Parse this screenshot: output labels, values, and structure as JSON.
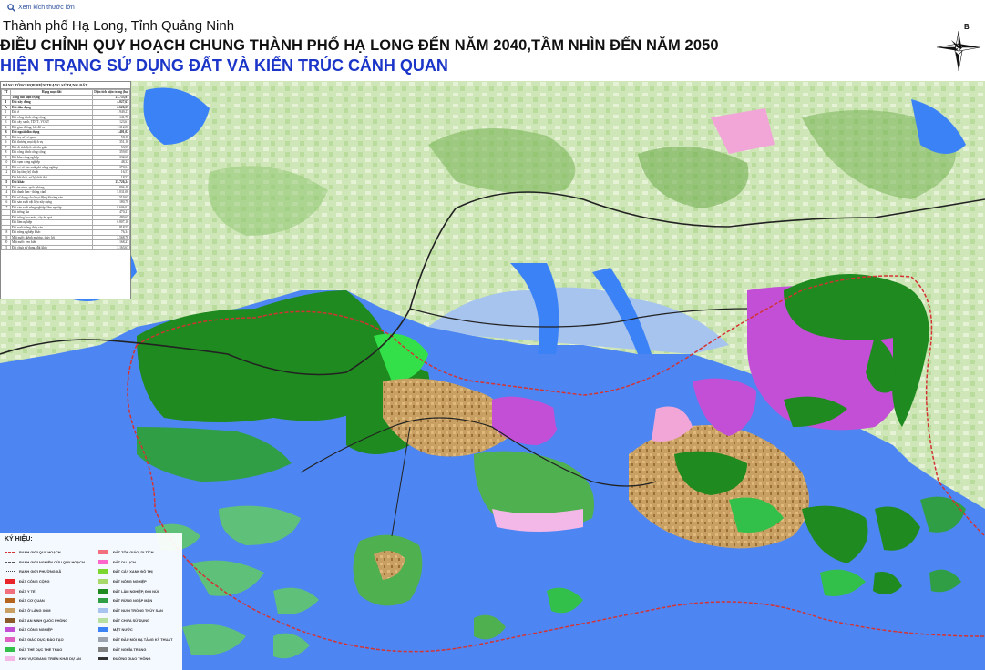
{
  "header": {
    "view_link": "Xem kích thước lớn",
    "location": "Thành phố Hạ Long, Tỉnh Quảng Ninh",
    "title": "ĐIỀU CHỈNH QUY HOẠCH CHUNG THÀNH PHỐ HẠ LONG ĐẾN NĂM 2040,TẦM NHÌN ĐẾN NĂM 2050",
    "subtitle": "HIỆN TRẠNG SỬ DỤNG ĐẤT VÀ KIẾN TRÚC CẢNH QUAN",
    "compass_letter": "B"
  },
  "stats": {
    "title": "BẢNG TỔNG HỢP HIỆN TRẠNG SỬ DỤNG ĐẤT",
    "col_tt": "TT",
    "col_name": "Hạng mục đất",
    "col_area": "Diện tích hiện trạng (ha)",
    "rows": [
      {
        "no": "",
        "name": "Tổng đất hiện trạng",
        "value": "27.753,91",
        "bold": true
      },
      {
        "no": "I",
        "name": "Đất xây dựng",
        "value": "4.027,67",
        "bold": true
      },
      {
        "no": "A",
        "name": "Đất dân dụng",
        "value": "2.626,55",
        "bold": true
      },
      {
        "no": "1",
        "name": "Đất ở",
        "value": "1.949,27",
        "bold": false
      },
      {
        "no": "2",
        "name": "Đất công trình công cộng",
        "value": "141,78",
        "bold": false
      },
      {
        "no": "3",
        "name": "Đất cây xanh, TDTT, VCGT",
        "value": "123,61",
        "bold": false
      },
      {
        "no": "4",
        "name": "Đất giao thông, bãi đỗ xe",
        "value": "1.312,06",
        "bold": false
      },
      {
        "no": "B",
        "name": "Đất ngoài dân dụng",
        "value": "1.401,02",
        "bold": true
      },
      {
        "no": "5",
        "name": "Đất trụ sở cơ quan",
        "value": "58,18",
        "bold": false
      },
      {
        "no": "6",
        "name": "Đất thương mại dịch vụ",
        "value": "351,16",
        "bold": false
      },
      {
        "no": "7",
        "name": "Đất di tích lịch sử, tôn giáo",
        "value": "53,95",
        "bold": false
      },
      {
        "no": "8",
        "name": "Đất công trình công cộng",
        "value": "359,05",
        "bold": false
      },
      {
        "no": "9",
        "name": "Đất khu công nghiệp",
        "value": "332,68",
        "bold": false
      },
      {
        "no": "10",
        "name": "Đất cụm công nghiệp",
        "value": "48,32",
        "bold": false
      },
      {
        "no": "11",
        "name": "Đất cơ sở sản xuất phi nông nghiệp",
        "value": "370,54",
        "bold": false
      },
      {
        "no": "12",
        "name": "Đất hạ tầng kỹ thuật",
        "value": "16,57",
        "bold": false
      },
      {
        "no": "",
        "name": "Đất bãi thải, xử lý chất thải",
        "value": "18,57",
        "bold": false
      },
      {
        "no": "II",
        "name": "Đất khác",
        "value": "23.726,24",
        "bold": true
      },
      {
        "no": "13",
        "name": "Đất an ninh, quốc phòng",
        "value": "806,48",
        "bold": false
      },
      {
        "no": "14",
        "name": "Đất danh lam - thắng cảnh",
        "value": "5.031,06",
        "bold": false
      },
      {
        "no": "15",
        "name": "Đất sử dụng cho hoạt động khoáng sản",
        "value": "1.519,65",
        "bold": false
      },
      {
        "no": "16",
        "name": "Đất sản xuất vật liệu xây dựng",
        "value": "180,78",
        "bold": false
      },
      {
        "no": "17",
        "name": "Đất sản xuất nông nghiệp, lâm nghiệp",
        "value": "9.606,01",
        "bold": false
      },
      {
        "no": "",
        "name": "Đất trồng lúa",
        "value": "470,21",
        "bold": false
      },
      {
        "no": "",
        "name": "Đất trồng hoa màu, cây ăn quả",
        "value": "1.490,65",
        "bold": false
      },
      {
        "no": "",
        "name": "Đất lâm nghiệp",
        "value": "6.807,16",
        "bold": false
      },
      {
        "no": "",
        "name": "Đất nuôi trồng thủy sản",
        "value": "818,55",
        "bold": false
      },
      {
        "no": "18",
        "name": "Đất nông nghiệp khác",
        "value": "76,34",
        "bold": false
      },
      {
        "no": "19",
        "name": "Mặt nước, kênh mương, thủy lợi",
        "value": "2.568,76",
        "bold": false
      },
      {
        "no": "20",
        "name": "Mặt nước ven biển",
        "value": "168,27",
        "bold": false
      },
      {
        "no": "21",
        "name": "Đất chưa sử dụng, đất khác",
        "value": "3.163,67",
        "bold": false
      }
    ]
  },
  "legend": {
    "title": "KÝ HIỆU:",
    "left": [
      {
        "label": "RANH GIỚI QUY HOẠCH",
        "color": "#d33333",
        "kind": "line"
      },
      {
        "label": "RANH GIỚI NGHIÊN CỨU QUY HOẠCH",
        "color": "#555555",
        "kind": "line2"
      },
      {
        "label": "RANH GIỚI PHƯỜNG XÃ",
        "color": "#444444",
        "kind": "line3"
      },
      {
        "label": "ĐẤT CÔNG CỘNG",
        "color": "#e8232a",
        "kind": "fill"
      },
      {
        "label": "ĐẤT Y TẾ",
        "color": "#f2707d",
        "kind": "fill"
      },
      {
        "label": "ĐẤT CƠ QUAN",
        "color": "#b5651d",
        "kind": "fill"
      },
      {
        "label": "ĐẤT Ở LÀNG XÓM",
        "color": "#c8a063",
        "kind": "fill"
      },
      {
        "label": "ĐẤT AN NINH QUỐC PHÒNG",
        "color": "#8b5a2b",
        "kind": "fill"
      },
      {
        "label": "ĐẤT CÔNG NGHIỆP",
        "color": "#c24fd6",
        "kind": "fill"
      },
      {
        "label": "ĐẤT GIÁO DỤC, ĐÀO TẠO",
        "color": "#e05fc5",
        "kind": "fill"
      },
      {
        "label": "ĐẤT THỂ DỤC THỂ THAO",
        "color": "#33c04a",
        "kind": "fill"
      },
      {
        "label": "KHU VỰC ĐANG TRIỂN KHAI DỰ ÁN",
        "color": "#f4b8e8",
        "kind": "fill"
      }
    ],
    "right": [
      {
        "label": "ĐẤT TÔN GIÁO, DI TÍCH",
        "color": "#f2707d",
        "kind": "fill"
      },
      {
        "label": "ĐẤT DU LỊCH",
        "color": "#ff66cc",
        "kind": "fill"
      },
      {
        "label": "ĐẤT CÂY XANH ĐÔ THỊ",
        "color": "#7bd62e",
        "kind": "fill"
      },
      {
        "label": "ĐẤT NÔNG NGHIỆP",
        "color": "#a6d96a",
        "kind": "fill"
      },
      {
        "label": "ĐẤT LÂM NGHIỆP, ĐỒI NÚI",
        "color": "#1f8a1f",
        "kind": "fill"
      },
      {
        "label": "ĐẤT RỪNG NGẬP MẶN",
        "color": "#2f9e44",
        "kind": "fill"
      },
      {
        "label": "ĐẤT NUÔI TRỒNG THỦY SẢN",
        "color": "#a7c4ee",
        "kind": "fill"
      },
      {
        "label": "ĐẤT CHƯA SỬ DỤNG",
        "color": "#b7e0a0",
        "kind": "fill"
      },
      {
        "label": "MẶT NƯỚC",
        "color": "#3b82f6",
        "kind": "fill"
      },
      {
        "label": "ĐẤT ĐẦU MỐI HẠ TẦNG KỸ THUẬT",
        "color": "#9ca3af",
        "kind": "fill"
      },
      {
        "label": "ĐẤT NGHĨA TRANG",
        "color": "#808080",
        "kind": "fill"
      },
      {
        "label": "ĐƯỜNG GIAO THÔNG",
        "color": "#222222",
        "kind": "road"
      }
    ]
  },
  "colors": {
    "sea": "#4d86f2",
    "forest": "#1f8a1f",
    "urban": "#c8a063",
    "industry": "#c24fd6",
    "rural": "#cfe6b8",
    "aquaculture": "#a7c4ee",
    "boundary": "#d33333"
  }
}
